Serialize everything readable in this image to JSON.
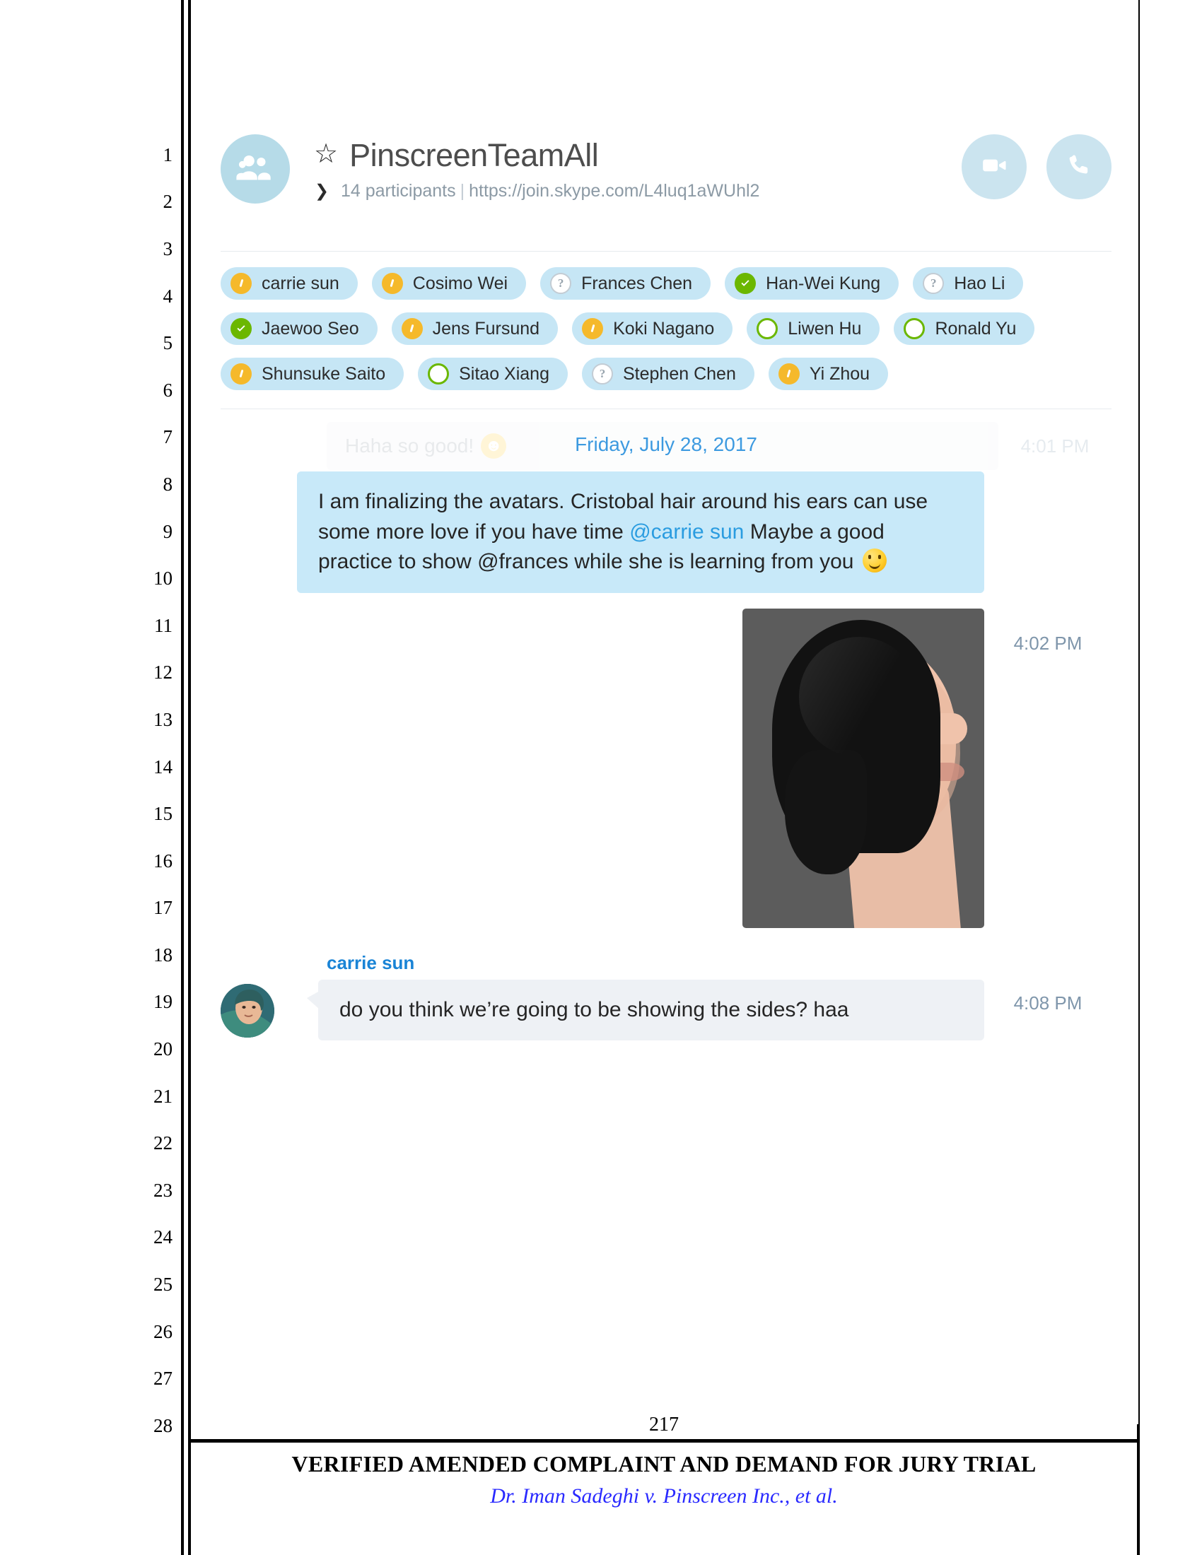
{
  "document": {
    "line_numbers": [
      "1",
      "2",
      "3",
      "4",
      "5",
      "6",
      "7",
      "8",
      "9",
      "10",
      "11",
      "12",
      "13",
      "14",
      "15",
      "16",
      "17",
      "18",
      "19",
      "20",
      "21",
      "22",
      "23",
      "24",
      "25",
      "26",
      "27",
      "28"
    ],
    "page_number": "217",
    "footer_title": "VERIFIED AMENDED COMPLAINT AND DEMAND FOR JURY TRIAL",
    "footer_case": "Dr. Iman Sadeghi v. Pinscreen Inc., et al."
  },
  "chat": {
    "header": {
      "group_avatar_icon": "group-people-icon",
      "favorite_icon": "star-icon",
      "expand_icon": "chevron-down-icon",
      "title": "PinscreenTeamAll",
      "participant_count": "14 participants",
      "separator": "|",
      "join_url": "https://join.skype.com/L4luq1aWUhl2",
      "video_call_label": "video-call",
      "audio_call_label": "audio-call"
    },
    "participants": [
      {
        "name": "carrie sun",
        "status": "away"
      },
      {
        "name": "Cosimo Wei",
        "status": "away"
      },
      {
        "name": "Frances Chen",
        "status": "unknown"
      },
      {
        "name": "Han-Wei Kung",
        "status": "online"
      },
      {
        "name": "Hao Li",
        "status": "unknown"
      },
      {
        "name": "Jaewoo Seo",
        "status": "online"
      },
      {
        "name": "Jens Fursund",
        "status": "away"
      },
      {
        "name": "Koki Nagano",
        "status": "away"
      },
      {
        "name": "Liwen Hu",
        "status": "offline"
      },
      {
        "name": "Ronald Yu",
        "status": "offline"
      },
      {
        "name": "Shunsuke Saito",
        "status": "away"
      },
      {
        "name": "Sitao Xiang",
        "status": "offline"
      },
      {
        "name": "Stephen Chen",
        "status": "unknown"
      },
      {
        "name": "Yi Zhou",
        "status": "away"
      }
    ],
    "faded_message": {
      "text": "Haha so good!",
      "emoji": "grinning-face",
      "time": "4:01 PM"
    },
    "date_divider": "Friday, July 28, 2017",
    "messages": [
      {
        "direction": "outgoing",
        "text_part_1": "I am finalizing the avatars. Cristobal hair around his ears can use some more love if you have time ",
        "mention": "@carrie sun",
        "text_part_2": " Maybe a good practice to show @frances while she is learning from you ",
        "emoji": "slightly-smiling-face",
        "time": ""
      },
      {
        "direction": "outgoing-attachment",
        "attachment_alt": "3d-avatar-head-side-profile-render",
        "time": "4:02 PM"
      },
      {
        "direction": "incoming",
        "sender": "carrie sun",
        "text": "do you think we’re going to be showing the sides? haa",
        "time": "4:08 PM"
      }
    ]
  },
  "colors": {
    "outgoing_bubble": "#c8e9f9",
    "incoming_bubble": "#eef1f5",
    "accent_blue": "#1a84d6",
    "date_blue": "#3d9ae0",
    "chip_bg": "#c6e6f5",
    "status_away": "#f5b92b",
    "status_online": "#6bb700",
    "status_offline_ring": "#6bb700",
    "avatar_circle": "#b6dbe8",
    "action_circle": "#cbe4ef",
    "case_caption": "#2a2aff"
  }
}
